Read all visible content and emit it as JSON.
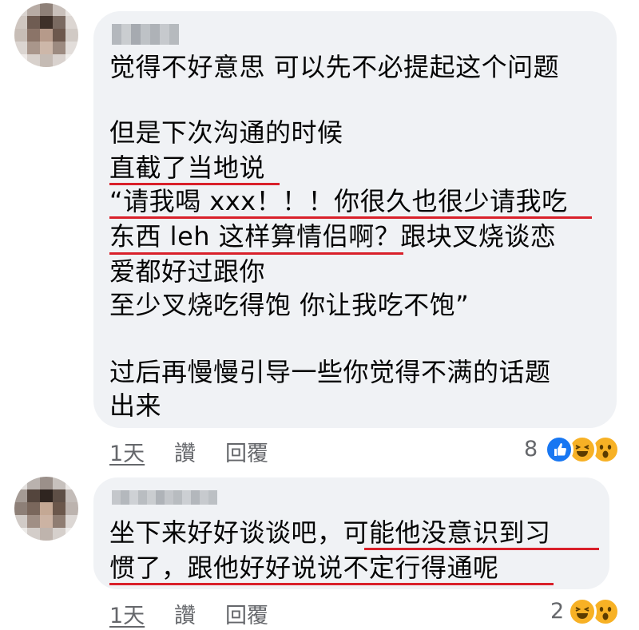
{
  "comments": [
    {
      "lines": [
        "觉得不好意思 可以先不必提起这个问题",
        "但是下次沟通的时候",
        "直截了当地说",
        "“请我喝 xxx！！！你很久也很少请我吃",
        "东西 leh 这样算情侣啊？跟块叉烧谈恋",
        "爱都好过跟你",
        "至少叉烧吃得饱 你让我吃不饱”",
        "过后再慢慢引导一些你觉得不满的话题",
        "出来"
      ],
      "time": "1天",
      "like_label": "讚",
      "reply_label": "回覆",
      "reaction_count": "8",
      "reactions": [
        "like-icon",
        "haha-icon",
        "wow-icon"
      ]
    },
    {
      "lines": [
        "坐下来好好谈谈吧，可能他没意识到习",
        "惯了，跟他好好说说不定行得通呢"
      ],
      "time": "1天",
      "like_label": "讚",
      "reply_label": "回覆",
      "reaction_count": "2",
      "reactions": [
        "haha-icon",
        "wow-icon"
      ]
    }
  ],
  "colors": {
    "bubble": "#f0f2f5",
    "underline": "#d9202a",
    "meta": "#65676b",
    "like": "#1877f2",
    "haha_wow": "#f7b125"
  }
}
